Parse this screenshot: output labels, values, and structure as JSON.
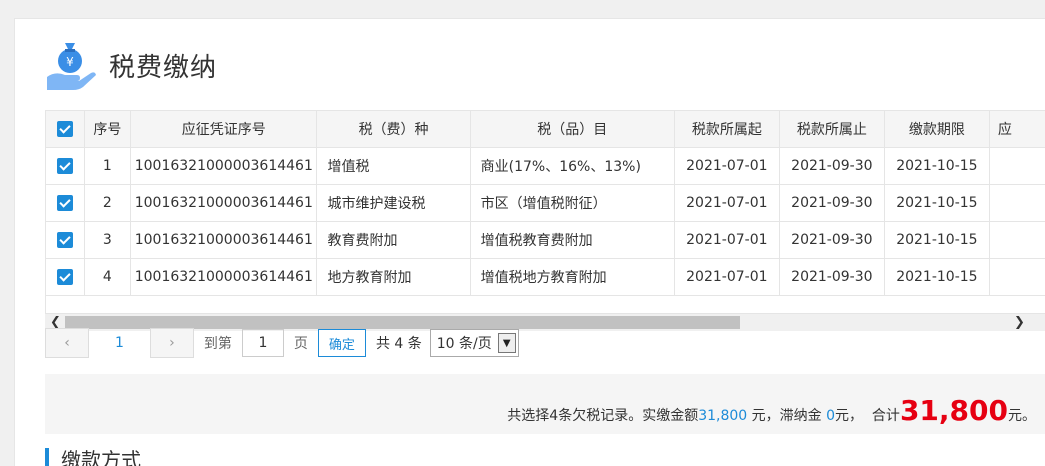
{
  "page": {
    "title": "税费缴纳",
    "icon": "money-bag-hand-icon"
  },
  "table": {
    "headers": [
      "序号",
      "应征凭证序号",
      "税（费）种",
      "税（品）目",
      "税款所属起",
      "税款所属止",
      "缴款期限",
      "应"
    ],
    "rows": [
      {
        "checked": true,
        "no": "1",
        "voucher": "10016321000003614461",
        "tax_type": "增值税",
        "tax_item": "商业(17%、16%、13%)",
        "start": "2021-07-01",
        "end": "2021-09-30",
        "deadline": "2021-10-15"
      },
      {
        "checked": true,
        "no": "2",
        "voucher": "10016321000003614461",
        "tax_type": "城市维护建设税",
        "tax_item": "市区（增值税附征）",
        "start": "2021-07-01",
        "end": "2021-09-30",
        "deadline": "2021-10-15"
      },
      {
        "checked": true,
        "no": "3",
        "voucher": "10016321000003614461",
        "tax_type": "教育费附加",
        "tax_item": "增值税教育费附加",
        "start": "2021-07-01",
        "end": "2021-09-30",
        "deadline": "2021-10-15"
      },
      {
        "checked": true,
        "no": "4",
        "voucher": "10016321000003614461",
        "tax_type": "地方教育附加",
        "tax_item": "增值税地方教育附加",
        "start": "2021-07-01",
        "end": "2021-09-30",
        "deadline": "2021-10-15"
      }
    ]
  },
  "pager": {
    "prev": "‹",
    "current_page": "1",
    "next": "›",
    "goto_label": "到第",
    "goto_value": "1",
    "page_unit": "页",
    "confirm": "确定",
    "total_text": "共 4 条",
    "page_size": "10 条/页"
  },
  "summary": {
    "prefix": "共选择4条欠税记录。实缴金额",
    "paid_amount": "31,800",
    "mid1": " 元，滞纳金 ",
    "late_fee": "0",
    "mid2": "元，  合计",
    "total": "31,800",
    "suffix": "元。"
  },
  "section": {
    "title": "缴款方式"
  },
  "colors": {
    "accent": "#1c8bd8",
    "total_red": "#e60012"
  }
}
